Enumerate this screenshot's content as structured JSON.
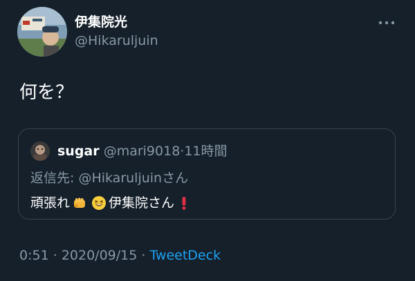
{
  "author": {
    "name": "伊集院光",
    "handle": "@Hikaruljuin",
    "avatar_icon": "profile-photo-avatar"
  },
  "menu": {
    "more_icon": "more-horizontal-icon"
  },
  "tweet": {
    "text": "何を？"
  },
  "quoted_tweet": {
    "name": "sugar",
    "handle": "@mari9018",
    "separator": "·",
    "time": "11時間",
    "reply_to": "返信先: @Hikaruljuinさん",
    "text_before": "頑張れ",
    "emoji_1": "oncoming-fist-emoji",
    "emoji_2": "grinning-squinting-face-emoji",
    "text_after": "伊集院さん",
    "emoji_3": "red-exclamation-mark-emoji"
  },
  "meta": {
    "time": "0:51",
    "separator_1": "·",
    "date": "2020/09/15",
    "separator_2": "·",
    "source": "TweetDeck"
  },
  "colors": {
    "background": "#15202b",
    "primary_text": "#ffffff",
    "secondary_text": "#8899a6",
    "link": "#1da1f2",
    "border": "#38444d"
  }
}
